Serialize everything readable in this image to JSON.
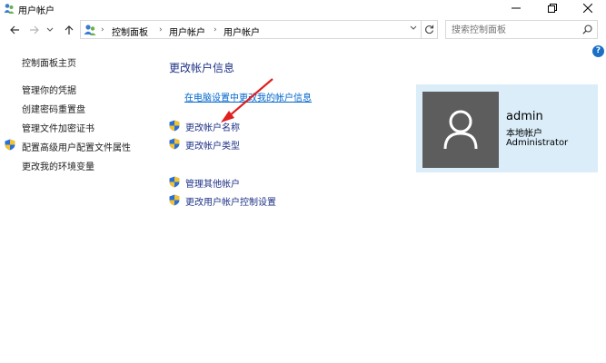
{
  "window": {
    "title": "用户帐户",
    "minimize_icon": "minimize-icon",
    "maximize_icon": "maximize-icon",
    "close_icon": "close-icon"
  },
  "nav": {
    "back_icon": "back-arrow-icon",
    "forward_icon": "forward-arrow-icon",
    "recent_icon": "chevron-down-icon",
    "up_icon": "up-arrow-icon",
    "breadcrumbs": [
      "控制面板",
      "用户帐户",
      "用户帐户"
    ],
    "refresh_icon": "refresh-icon"
  },
  "search": {
    "placeholder": "搜索控制面板",
    "icon": "search-icon"
  },
  "help_label": "?",
  "sidebar": {
    "items": [
      {
        "label": "控制面板主页",
        "shield": false
      },
      {
        "label": "管理你的凭据",
        "shield": false
      },
      {
        "label": "创建密码重置盘",
        "shield": false
      },
      {
        "label": "管理文件加密证书",
        "shield": false
      },
      {
        "label": "配置高级用户配置文件属性",
        "shield": true
      },
      {
        "label": "更改我的环境变量",
        "shield": false
      }
    ]
  },
  "main": {
    "heading": "更改帐户信息",
    "pc_settings_link": "在电脑设置中更改我的帐户信息",
    "tasks": [
      {
        "label": "更改帐户名称"
      },
      {
        "label": "更改帐户类型"
      },
      {
        "label": "管理其他帐户"
      },
      {
        "label": "更改用户帐户控制设置"
      }
    ]
  },
  "account": {
    "name": "admin",
    "type": "本地帐户",
    "role": "Administrator",
    "card_color": "#daedf9",
    "avatar_color": "#5d5d5d"
  },
  "colors": {
    "link": "#0066cc",
    "heading": "#1e3287",
    "annotation_arrow": "#e0201f"
  }
}
